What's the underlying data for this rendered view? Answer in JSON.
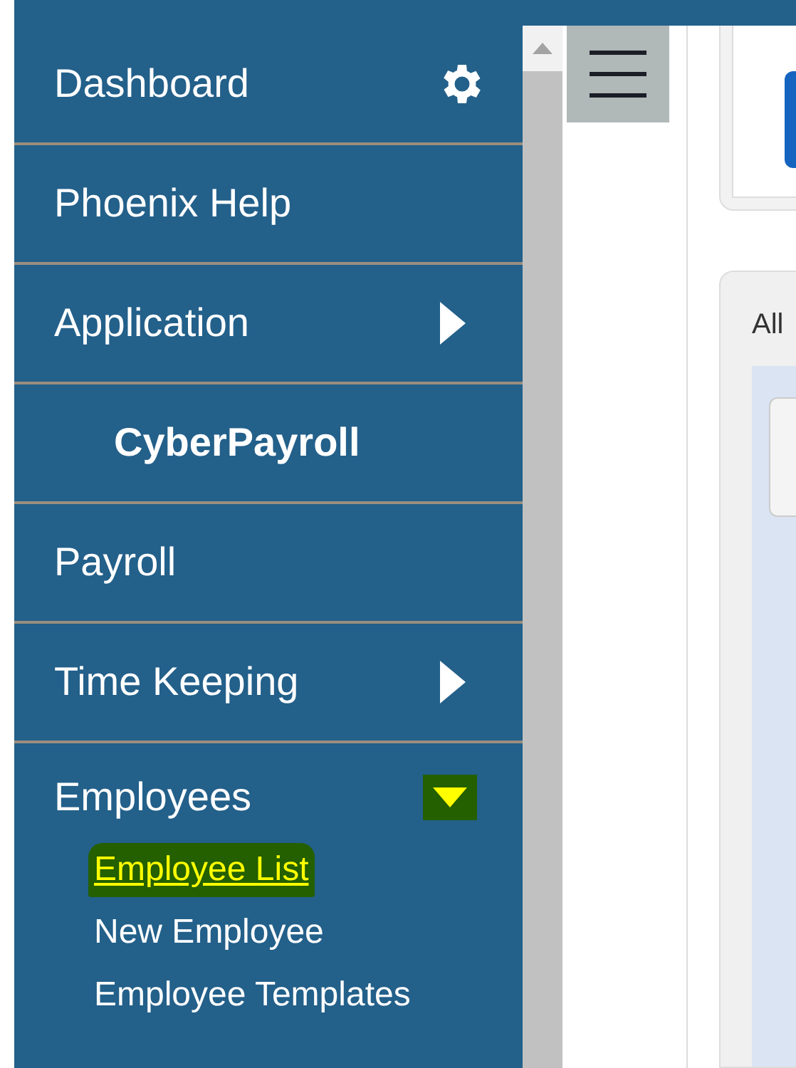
{
  "sidebar": {
    "items": [
      {
        "label": "Dashboard",
        "kind": "settings"
      },
      {
        "label": "Phoenix Help",
        "kind": "link"
      },
      {
        "label": "Application",
        "kind": "submenu",
        "expanded": false
      },
      {
        "label": "CyberPayroll",
        "kind": "heading"
      },
      {
        "label": "Payroll",
        "kind": "link"
      },
      {
        "label": "Time Keeping",
        "kind": "submenu",
        "expanded": false
      },
      {
        "label": "Employees",
        "kind": "submenu",
        "expanded": true,
        "children": [
          {
            "label": "Employee List",
            "selected": true
          },
          {
            "label": "New Employee",
            "selected": false
          },
          {
            "label": "Employee Templates",
            "selected": false
          }
        ]
      }
    ]
  },
  "panel": {
    "title": "All"
  }
}
